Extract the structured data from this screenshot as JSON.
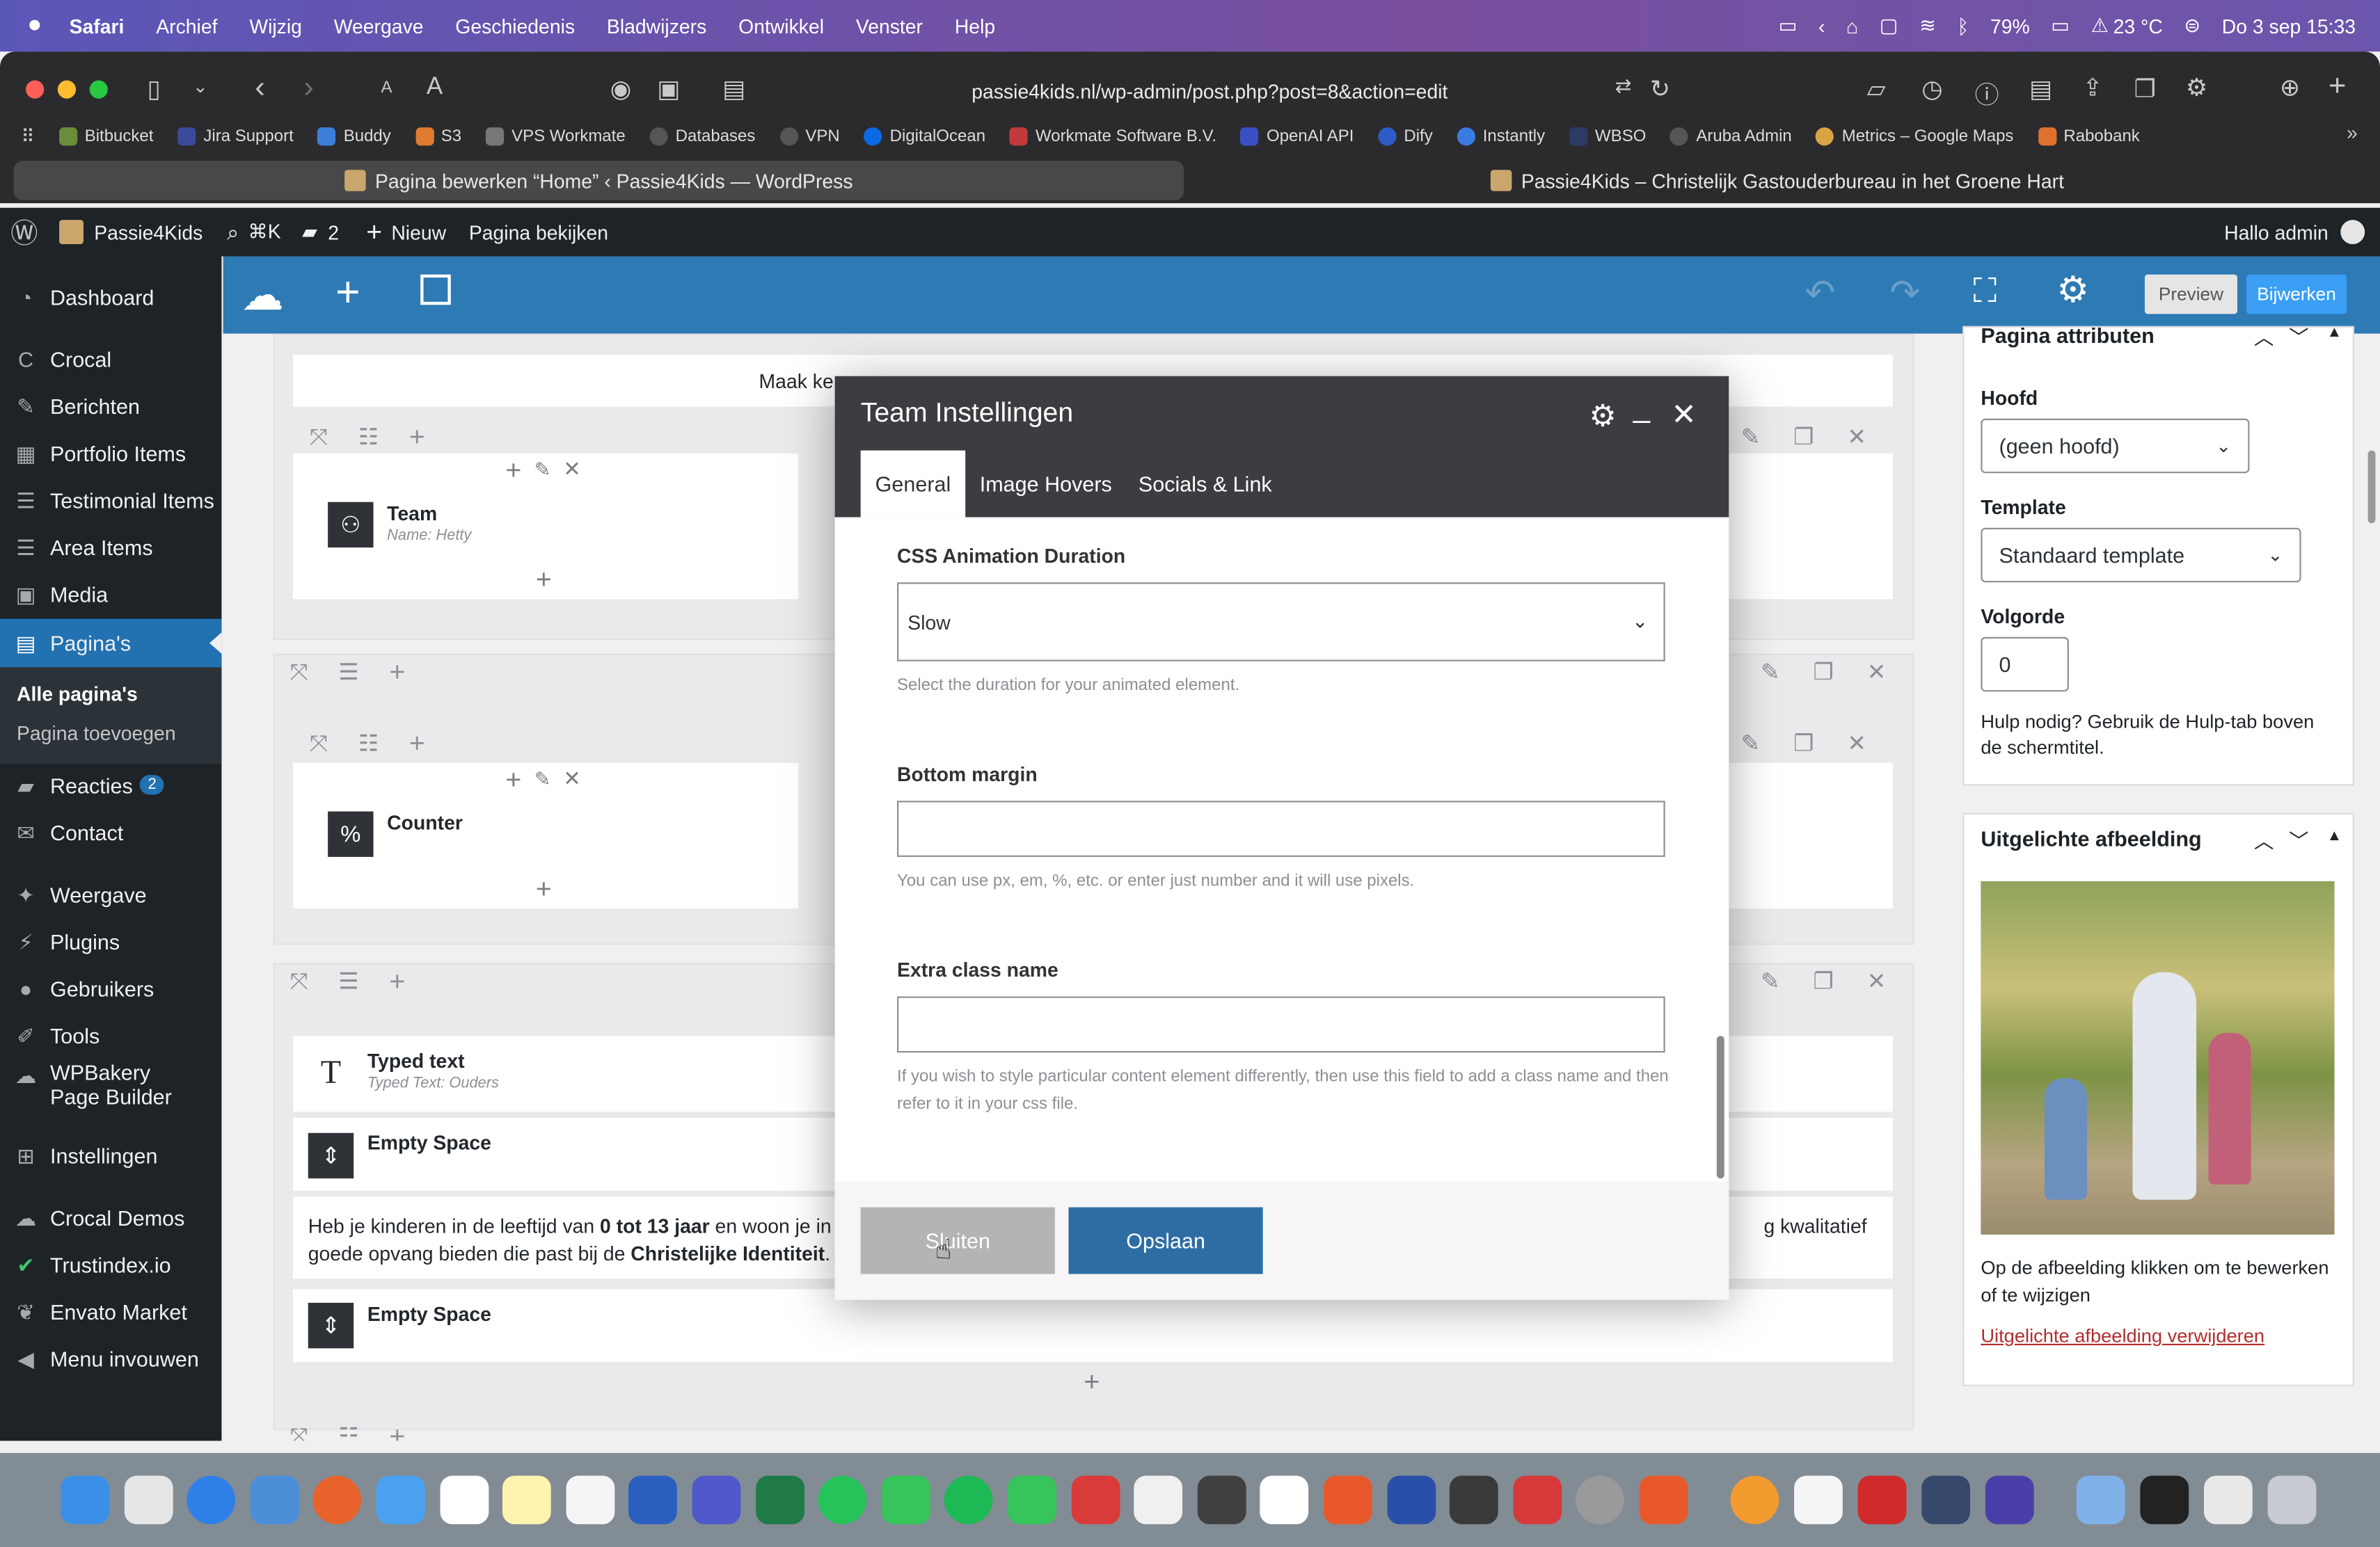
{
  "menubar": {
    "app": "Safari",
    "items": [
      "Archief",
      "Wijzig",
      "Weergave",
      "Geschiedenis",
      "Bladwijzers",
      "Ontwikkel",
      "Venster",
      "Help"
    ],
    "battery": "79%",
    "weather": "23 °C",
    "datetime": "Do 3 sep  15:33"
  },
  "browser": {
    "url": "passie4kids.nl/wp-admin/post.php?post=8&action=edit",
    "bookmarks": [
      "Bitbucket",
      "Jira Support",
      "Buddy",
      "S3",
      "VPS Workmate",
      "Databases",
      "VPN",
      "DigitalOcean",
      "Workmate Software B.V.",
      "OpenAI API",
      "Dify",
      "Instantly",
      "WBSO",
      "Aruba Admin",
      "Metrics – Google Maps",
      "Rabobank"
    ],
    "tabs": [
      {
        "title": "Pagina bewerken “Home” ‹ Passie4Kids — WordPress"
      },
      {
        "title": "Passie4Kids – Christelijk Gastouderbureau in het Groene Hart"
      }
    ]
  },
  "adminbar": {
    "site": "Passie4Kids",
    "shortcut": "⌘K",
    "comments": "2",
    "new": "Nieuw",
    "view": "Pagina bekijken",
    "greeting": "Hallo admin"
  },
  "sidebar": {
    "items": [
      {
        "label": "Dashboard"
      },
      {
        "label": "Crocal"
      },
      {
        "label": "Berichten"
      },
      {
        "label": "Portfolio Items"
      },
      {
        "label": "Testimonial Items"
      },
      {
        "label": "Area Items"
      },
      {
        "label": "Media"
      },
      {
        "label": "Pagina's"
      },
      {
        "label": "Reacties"
      },
      {
        "label": "Contact"
      },
      {
        "label": "Weergave"
      },
      {
        "label": "Plugins"
      },
      {
        "label": "Gebruikers"
      },
      {
        "label": "Tools"
      },
      {
        "label": "WPBakery Page Builder"
      },
      {
        "label": "Instellingen"
      },
      {
        "label": "Crocal Demos"
      },
      {
        "label": "Trustindex.io"
      },
      {
        "label": "Envato Market"
      },
      {
        "label": "Menu invouwen"
      }
    ],
    "sub": [
      "Alle pagina's",
      "Pagina toevoegen"
    ],
    "reacties_badge": "2"
  },
  "toolbar": {
    "preview": "Preview",
    "update": "Bijwerken"
  },
  "canvas": {
    "top_text": "Maak ker",
    "team": {
      "title": "Team",
      "sub": "Name: Hetty"
    },
    "counter": {
      "title": "Counter"
    },
    "typed": {
      "title": "Typed text",
      "sub": "Typed Text: Ouders"
    },
    "empty1": "Empty Space",
    "empty2": "Empty Space",
    "para_a": "Heb je kinderen in de leeftijd van ",
    "para_b": "0 tot 13 jaar",
    "para_c": " en woon je in he",
    "para_d": "g kwalitatief",
    "para_e": "goede opvang bieden die past bij de ",
    "para_f": "Christelijke Identiteit",
    "para_g": "."
  },
  "panel": {
    "attr_title": "Pagina attributen",
    "hoofd_label": "Hoofd",
    "hoofd_value": "(geen hoofd)",
    "template_label": "Template",
    "template_value": "Standaard template",
    "order_label": "Volgorde",
    "order_value": "0",
    "help": "Hulp nodig? Gebruik de Hulp-tab boven de schermtitel.",
    "featured_title": "Uitgelichte afbeelding",
    "featured_help": "Op de afbeelding klikken om te bewerken of te wijzigen",
    "featured_remove": "Uitgelichte afbeelding verwijderen"
  },
  "modal": {
    "title": "Team Instellingen",
    "tabs": [
      "General",
      "Image Hovers",
      "Socials & Link"
    ],
    "anim_label": "CSS Animation Duration",
    "anim_value": "Slow",
    "anim_help": "Select the duration for your animated element.",
    "margin_label": "Bottom margin",
    "margin_help": "You can use px, em, %, etc. or enter just number and it will use pixels.",
    "class_label": "Extra class name",
    "class_help": "If you wish to style particular content element differently, then use this field to add a class name and then refer to it in your css file.",
    "close": "Sluiten",
    "save": "Opslaan"
  },
  "colors": {
    "wp_blue": "#2271b1",
    "vc_bar": "#2e7ab4",
    "admin_dark": "#1d2327",
    "modal_head": "#3b3d41",
    "save_btn": "#2e6da4"
  }
}
